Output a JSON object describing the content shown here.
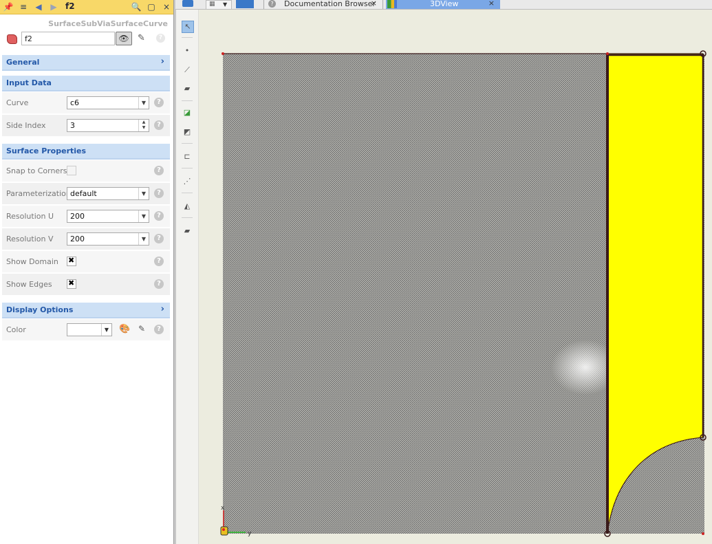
{
  "panel": {
    "title": "f2",
    "type_label": "SurfaceSubViaSurfaceCurve",
    "name_value": "f2",
    "sections": {
      "general": "General",
      "input_data": "Input Data",
      "surface_properties": "Surface Properties",
      "display_options": "Display Options"
    },
    "properties": {
      "curve": {
        "label": "Curve",
        "value": "c6"
      },
      "side_index": {
        "label": "Side Index",
        "value": "3"
      },
      "snap_to_corners": {
        "label": "Snap to Corners",
        "checked": false
      },
      "parameterization": {
        "label": "Parameterization",
        "value": "default"
      },
      "resolution_u": {
        "label": "Resolution U",
        "value": "200"
      },
      "resolution_v": {
        "label": "Resolution V",
        "value": "200"
      },
      "show_domain": {
        "label": "Show Domain",
        "checked": true
      },
      "show_edges": {
        "label": "Show Edges",
        "checked": true
      },
      "color": {
        "label": "Color",
        "value": ""
      }
    }
  },
  "tabs": {
    "documentation": "Documentation Browser",
    "view3d": "3DView"
  },
  "view": {
    "axis_x_label": "x",
    "axis_y_label": "y",
    "colors": {
      "surface_fill": "#ffff00",
      "hatch_background": "#8c8c8c",
      "edge": "#3a1a1a",
      "accent": "#3a78c8"
    }
  }
}
